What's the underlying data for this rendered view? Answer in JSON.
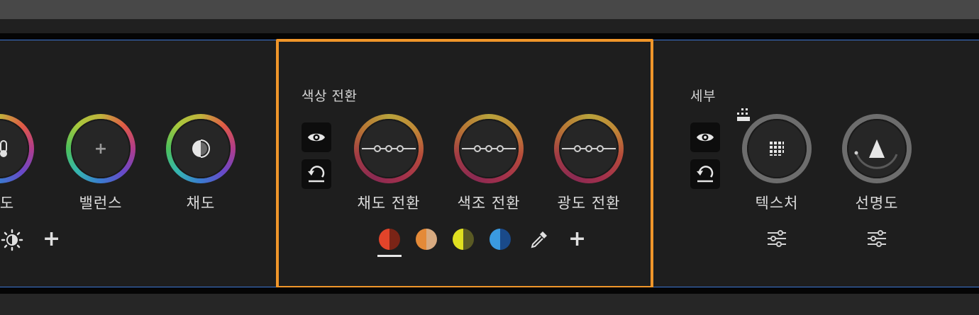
{
  "left_panel": {
    "cut_label": "도",
    "dials": [
      {
        "label": "밸런스",
        "icon": "plus-icon"
      },
      {
        "label": "채도",
        "icon": "saturation-icon"
      }
    ],
    "bottom_icons": [
      "sun-icon",
      "plus-icon"
    ]
  },
  "color_shift": {
    "title": "색상 전환",
    "visibility_icon": "eye-icon",
    "reset_icon": "undo-icon",
    "dials": [
      {
        "label": "채도 전환"
      },
      {
        "label": "색조 전환"
      },
      {
        "label": "광도 전환"
      }
    ],
    "swatches": [
      {
        "name": "red",
        "left": "#e2442a",
        "right": "#7a2416",
        "selected": true
      },
      {
        "name": "orange",
        "left": "#e48a38",
        "right": "#d8aa80"
      },
      {
        "name": "yellow",
        "left": "#e0e020",
        "right": "#5a5a24"
      },
      {
        "name": "blue",
        "left": "#3a9ae0",
        "right": "#1a4a8a"
      }
    ],
    "eyedropper_icon": "eyedropper-icon",
    "add_icon": "plus-icon"
  },
  "detail": {
    "title": "세부",
    "dials": [
      {
        "label": "텍스처",
        "icon": "texture-icon"
      },
      {
        "label": "선명도",
        "icon": "sharpen-icon"
      }
    ],
    "settings_icon": "sliders-icon"
  },
  "colors": {
    "highlight": "#f0962a",
    "panel_border": "#3d77d6"
  }
}
